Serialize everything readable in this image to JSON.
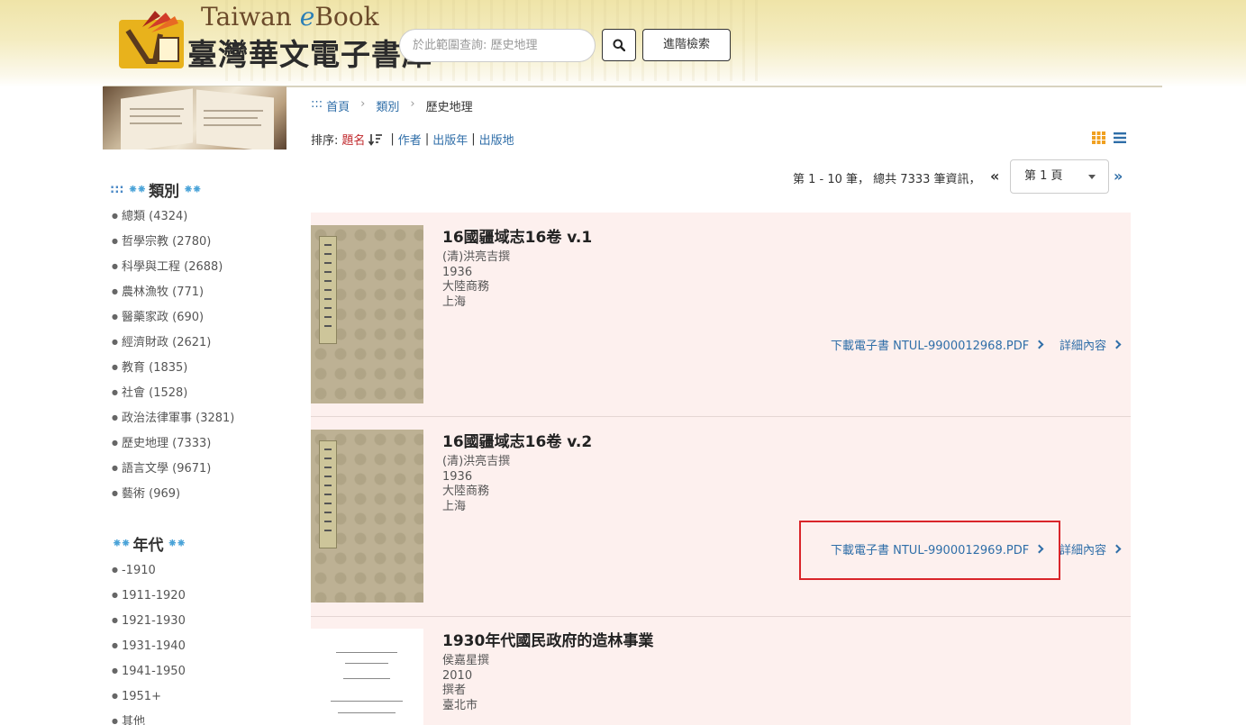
{
  "header": {
    "logo_en_prefix": "Taiwan ",
    "logo_en_e": "e",
    "logo_en_suffix": "Book",
    "logo_zh": "臺灣華文電子書庫",
    "search_placeholder": "於此範圍查詢: 歷史地理",
    "advanced_search_label": "進階檢索"
  },
  "sidebar": {
    "category_heading": "類別",
    "categories": [
      "總類 (4324)",
      "哲學宗教 (2780)",
      "科學與工程 (2688)",
      "農林漁牧 (771)",
      "醫藥家政 (690)",
      "經濟財政 (2621)",
      "教育 (1835)",
      "社會 (1528)",
      "政治法律軍事 (3281)",
      "歷史地理 (7333)",
      "語言文學 (9671)",
      "藝術 (969)"
    ],
    "era_heading": "年代",
    "eras": [
      "-1910",
      "1911-1920",
      "1921-1930",
      "1931-1940",
      "1941-1950",
      "1951+",
      "其他"
    ]
  },
  "breadcrumb": {
    "prefix": ":::",
    "home": "首頁",
    "category": "類別",
    "current": "歷史地理"
  },
  "sort": {
    "label": "排序:",
    "title": "題名",
    "author": "作者",
    "year": "出版年",
    "place": "出版地"
  },
  "pager": {
    "summary": "第 1 - 10 筆， 總共 7333 筆資訊，",
    "current_page": "第 1 頁"
  },
  "results": [
    {
      "title": "16國疆域志16卷 v.1",
      "author": "(清)洪亮吉撰",
      "year": "1936",
      "publisher": "大陸商務",
      "place": "上海",
      "download_label": "下載電子書 NTUL-9900012968.PDF",
      "detail_label": "詳細內容"
    },
    {
      "title": "16國疆域志16卷 v.2",
      "author": "(清)洪亮吉撰",
      "year": "1936",
      "publisher": "大陸商務",
      "place": "上海",
      "download_label": "下載電子書 NTUL-9900012969.PDF",
      "detail_label": "詳細內容"
    },
    {
      "title": "1930年代國民政府的造林事業",
      "author": "侯嘉星撰",
      "year": "2010",
      "publisher": "撰者",
      "place": "臺北市"
    }
  ],
  "colors": {
    "link": "#2f6ea8",
    "active_sort": "#c0282c",
    "result_bg": "#fdf0ee",
    "highlight": "#d9252a",
    "view_grid": "#f0a020"
  }
}
